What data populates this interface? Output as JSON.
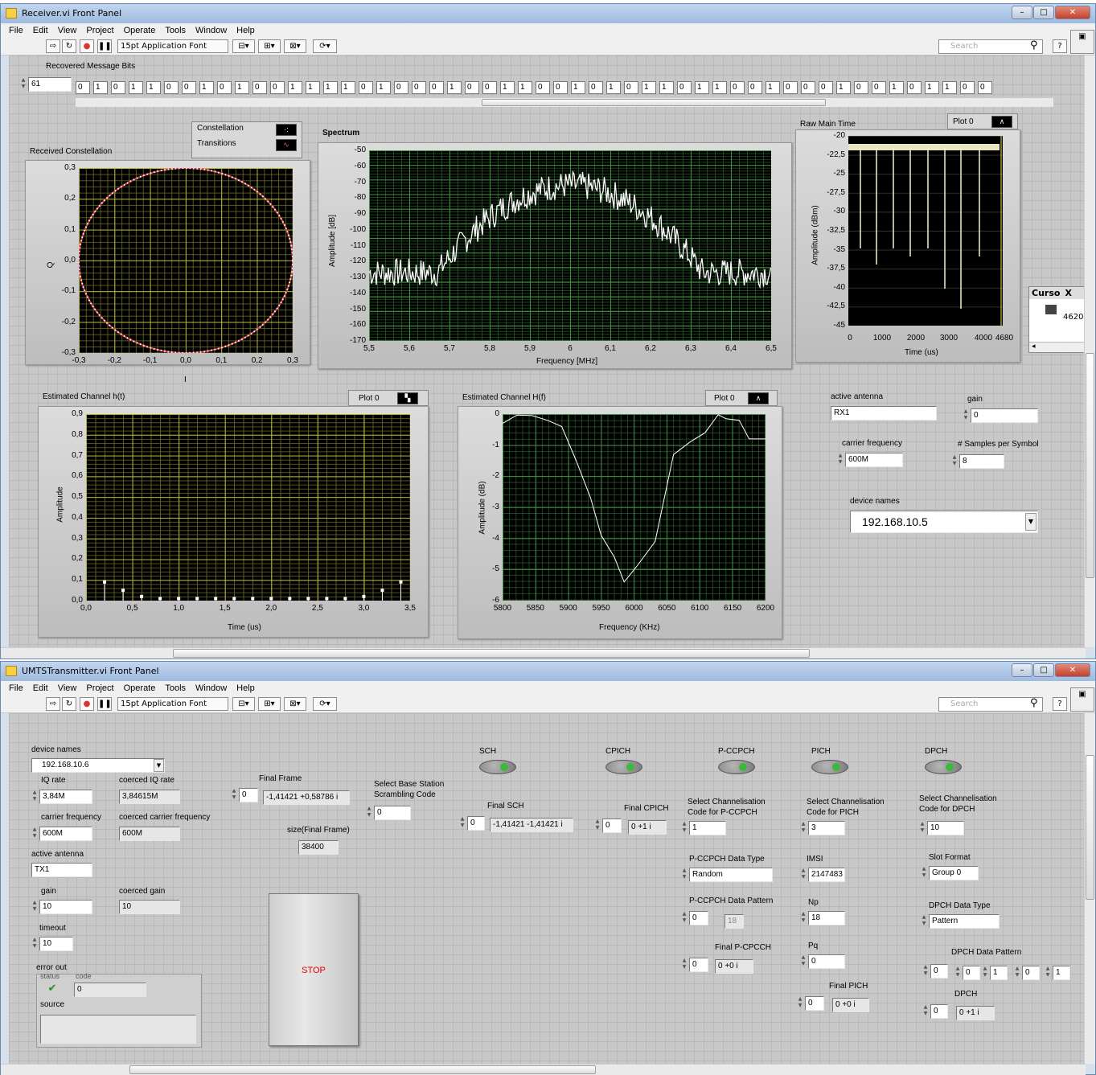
{
  "receiver": {
    "title": "Receiver.vi Front Panel",
    "menu": [
      "File",
      "Edit",
      "View",
      "Project",
      "Operate",
      "Tools",
      "Window",
      "Help"
    ],
    "font_selector": "15pt Application Font",
    "search_placeholder": "Search",
    "bits_label": "Recovered Message Bits",
    "bits_index": "61",
    "bits": [
      "0",
      "1",
      "0",
      "1",
      "1",
      "0",
      "0",
      "1",
      "0",
      "1",
      "0",
      "0",
      "1",
      "1",
      "1",
      "1",
      "0",
      "1",
      "0",
      "0",
      "0",
      "1",
      "0",
      "0",
      "1",
      "1",
      "0",
      "0",
      "1",
      "0",
      "1",
      "0",
      "1",
      "1",
      "0",
      "1",
      "1",
      "0",
      "0",
      "1",
      "0",
      "0",
      "0",
      "1",
      "0",
      "0",
      "1",
      "0",
      "1",
      "1",
      "0",
      "0"
    ],
    "constellation": {
      "title": "Received Constellation",
      "legend": [
        "Constellation",
        "Transitions"
      ],
      "xlabel": "I",
      "ylabel": "Q",
      "xticks": [
        "-0,3",
        "-0,2",
        "-0,1",
        "0,0",
        "0,1",
        "0,2",
        "0,3"
      ],
      "yticks": [
        "0,3",
        "0,2",
        "0,1",
        "0,0",
        "-0,1",
        "-0,2",
        "-0,3"
      ]
    },
    "spectrum": {
      "title": "Spectrum",
      "xlabel": "Frequency [MHz]",
      "ylabel": "Amplitude [dB]",
      "xticks": [
        "5,5",
        "5,6",
        "5,7",
        "5,8",
        "5,9",
        "6",
        "6,1",
        "6,2",
        "6,3",
        "6,4",
        "6,5"
      ],
      "yticks": [
        "-50",
        "-60",
        "-70",
        "-80",
        "-90",
        "-100",
        "-110",
        "-120",
        "-130",
        "-140",
        "-150",
        "-160",
        "-170"
      ]
    },
    "rawtime": {
      "title": "Raw Main Time",
      "plot_legend": "Plot 0",
      "xlabel": "Time (us)",
      "ylabel": "Amplitude (dBm)",
      "xticks": [
        "0",
        "1000",
        "2000",
        "3000",
        "4000",
        "4680"
      ],
      "yticks": [
        "-20",
        "-22,5",
        "-25",
        "-27,5",
        "-30",
        "-32,5",
        "-35",
        "-37,5",
        "-40",
        "-42,5",
        "-45"
      ]
    },
    "cursor": {
      "header": "Curso",
      "x_header": "X",
      "value": "4620"
    },
    "channel_ht": {
      "title": "Estimated Channel h(t)",
      "plot_legend": "Plot 0",
      "xlabel": "Time (us)",
      "ylabel": "Amplitude",
      "xticks": [
        "0,0",
        "0,5",
        "1,0",
        "1,5",
        "2,0",
        "2,5",
        "3,0",
        "3,5"
      ],
      "yticks": [
        "0,9",
        "0,8",
        "0,7",
        "0,6",
        "0,5",
        "0,4",
        "0,3",
        "0,2",
        "0,1",
        "0,0"
      ]
    },
    "channel_hf": {
      "title": "Estimated Channel H(f)",
      "plot_legend": "Plot 0",
      "xlabel": "Frequency (KHz)",
      "ylabel": "Amplitude (dB)",
      "xticks": [
        "5800",
        "5850",
        "5900",
        "5950",
        "6000",
        "6050",
        "6100",
        "6150",
        "6200"
      ],
      "yticks": [
        "0",
        "-1",
        "-2",
        "-3",
        "-4",
        "-5",
        "-6"
      ]
    },
    "controls": {
      "active_antenna_label": "active antenna",
      "active_antenna": "RX1",
      "gain_label": "gain",
      "gain": "0",
      "carrier_label": "carrier frequency",
      "carrier": "600M",
      "sps_label": "# Samples per Symbol",
      "sps": "8",
      "device_label": "device names",
      "device": "192.168.10.5"
    }
  },
  "transmitter": {
    "title": "UMTSTransmitter.vi Front Panel",
    "menu": [
      "File",
      "Edit",
      "View",
      "Project",
      "Operate",
      "Tools",
      "Window",
      "Help"
    ],
    "font_selector": "15pt Application Font",
    "search_placeholder": "Search",
    "device_label": "device names",
    "device": "192.168.10.6",
    "iq_rate_label": "IQ rate",
    "iq_rate": "3,84M",
    "coerced_iq_label": "coerced IQ rate",
    "coerced_iq": "3,84615M",
    "carrier_label": "carrier frequency",
    "carrier": "600M",
    "coerced_carrier_label": "coerced carrier frequency",
    "coerced_carrier": "600M",
    "antenna_label": "active antenna",
    "antenna": "TX1",
    "gain_label": "gain",
    "gain": "10",
    "coerced_gain_label": "coerced gain",
    "coerced_gain": "10",
    "timeout_label": "timeout",
    "timeout": "10",
    "error_label": "error out",
    "status_label": "status",
    "code_label": "code",
    "code": "0",
    "source_label": "source",
    "final_frame_label": "Final Frame",
    "final_frame_idx": "0",
    "final_frame": "-1,41421 +0,58786 i",
    "size_label": "size(Final Frame)",
    "size": "38400",
    "stop": "STOP",
    "scrambling_label": "Select Base Station Scrambling Code",
    "scrambling": "0",
    "sch_label": "SCH",
    "cpich_label": "CPICH",
    "pccpch_label": "P-CCPCH",
    "pich_label": "PICH",
    "dpch_label": "DPCH",
    "final_sch_label": "Final SCH",
    "final_sch_idx": "0",
    "final_sch": "-1,41421 -1,41421 i",
    "final_cpich_label": "Final CPICH",
    "final_cpich_idx": "0",
    "final_cpich": "0 +1 i",
    "chan_pccpch_label": "Select Channelisation Code for  P-CCPCH",
    "chan_pccpch": "1",
    "pccpch_type_label": "P-CCPCH Data Type",
    "pccpch_type": "Random",
    "pccpch_pattern_label": "P-CCPCH Data Pattern",
    "pccpch_pattern_idx": "0",
    "pccpch_pattern": "18",
    "final_pccpch_label": "Final P-CPCCH",
    "final_pccpch_idx": "0",
    "final_pccpch": "0 +0 i",
    "chan_pich_label": "Select Channelisation Code for PICH",
    "chan_pich": "3",
    "imsi_label": "IMSI",
    "imsi": "2147483",
    "np_label": "Np",
    "np": "18",
    "pq_label": "Pq",
    "pq": "0",
    "final_pich_label": "Final PICH",
    "final_pich_idx": "0",
    "final_pich": "0 +0 i",
    "chan_dpch_label": "Select Channelisation Code for DPCH",
    "chan_dpch": "10",
    "slot_label": "Slot Format",
    "slot": "Group 0",
    "dpch_type_label": "DPCH Data Type",
    "dpch_type": "Pattern",
    "dpch_pattern_label": "DPCH Data Pattern",
    "dpch_pattern_idx": "0",
    "dpch_pattern": [
      "0",
      "1",
      "0",
      "1"
    ],
    "dpch_label2": "DPCH",
    "dpch_idx": "0",
    "dpch_val": "0 +1 i"
  }
}
